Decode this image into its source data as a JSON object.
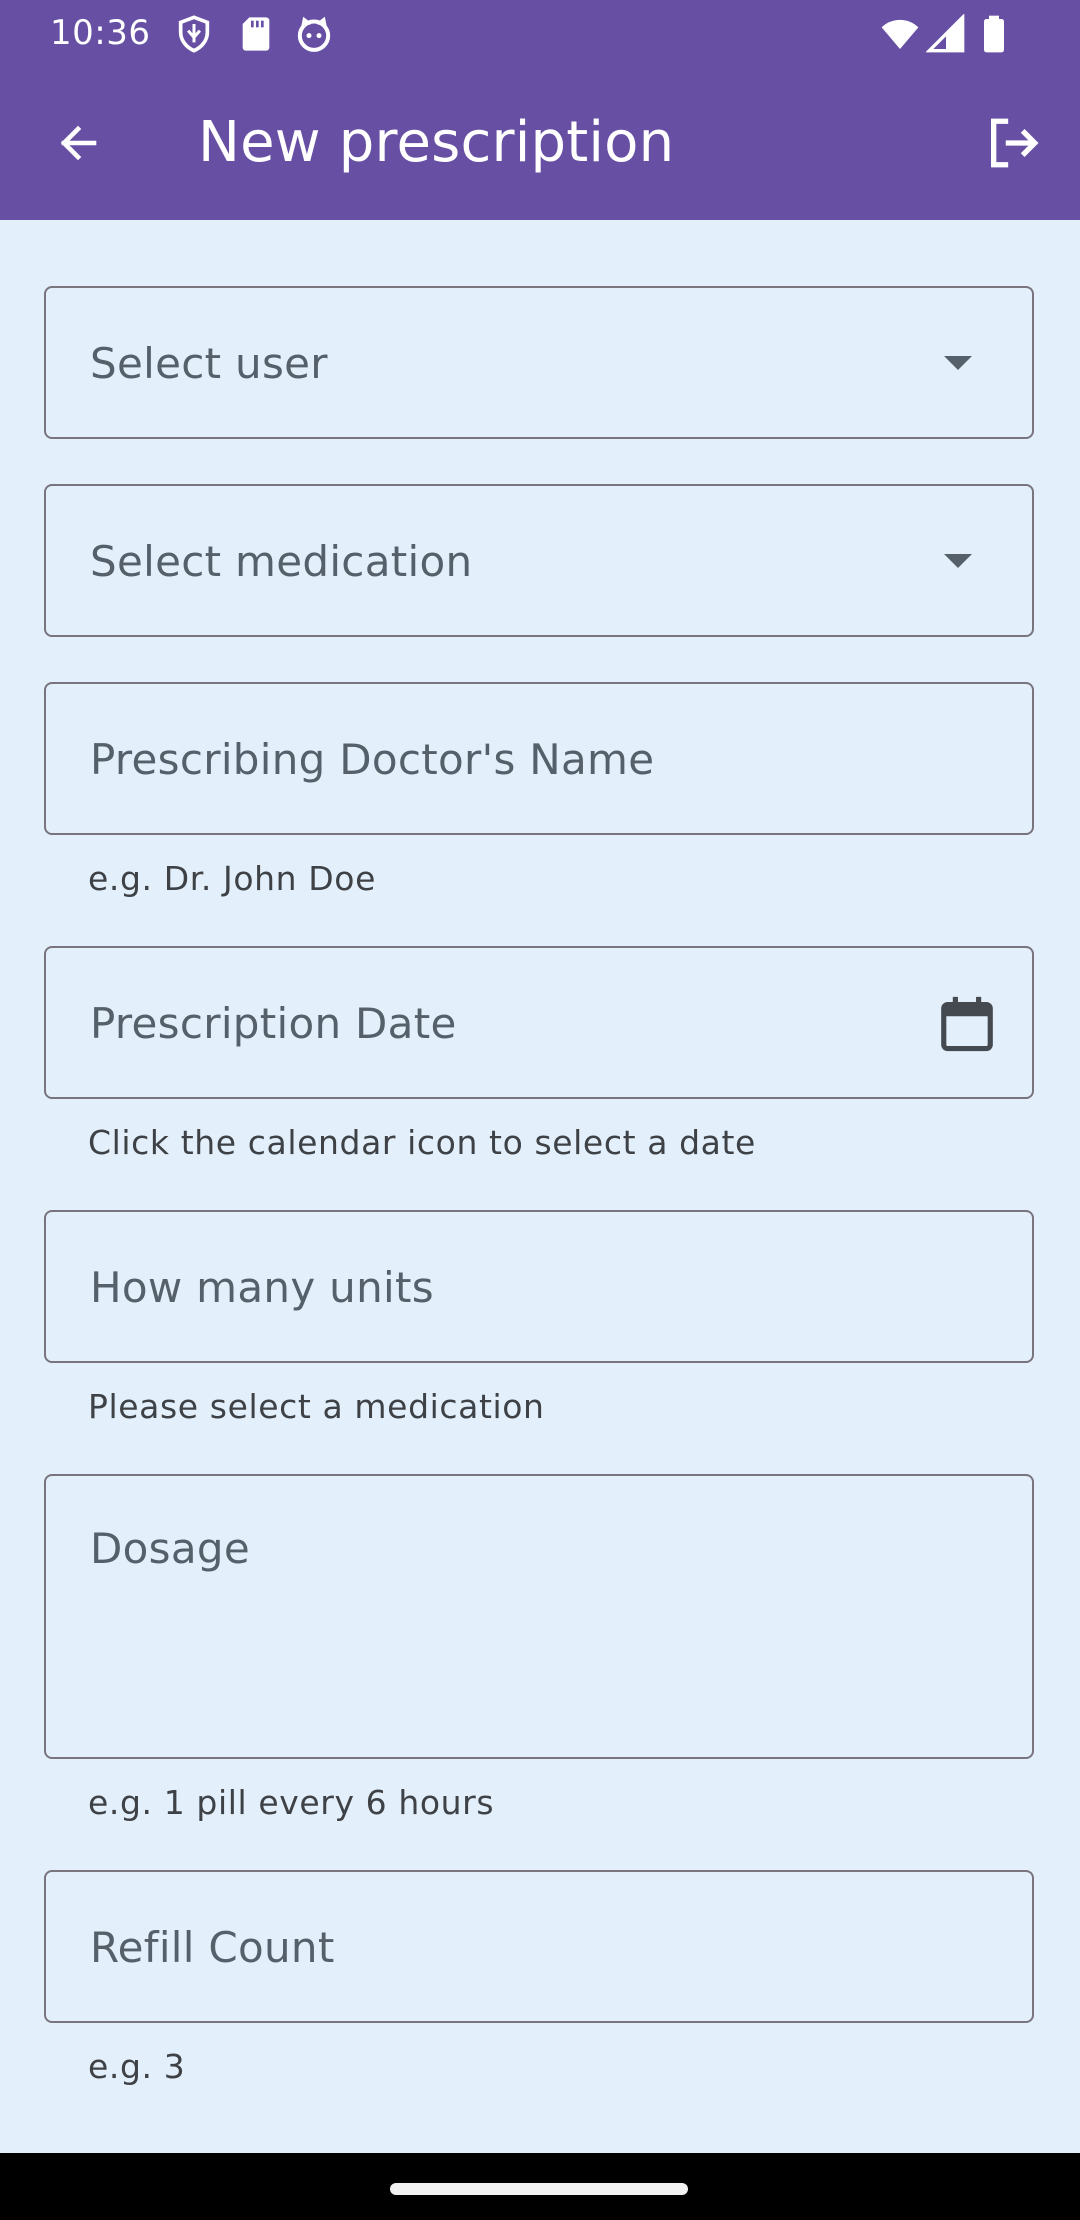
{
  "status_bar": {
    "time": "10:36",
    "icons": [
      "shield-icon",
      "sd-card-icon",
      "cat-face-icon",
      "wifi-icon",
      "signal-icon",
      "battery-icon"
    ]
  },
  "app_bar": {
    "title": "New prescription",
    "back_icon": "arrow-back-icon",
    "logout_icon": "logout-icon",
    "color": "#6750a4"
  },
  "form": {
    "user_select": {
      "placeholder": "Select user"
    },
    "medication_select": {
      "placeholder": "Select medication"
    },
    "doctor_name": {
      "placeholder": "Prescribing Doctor's Name",
      "helper": "e.g. Dr. John Doe"
    },
    "prescription_date": {
      "placeholder": "Prescription Date",
      "helper": "Click the calendar icon to select a date"
    },
    "units": {
      "placeholder": "How many units",
      "helper": "Please select a medication"
    },
    "dosage": {
      "placeholder": "Dosage",
      "helper": "e.g. 1 pill every 6 hours"
    },
    "refill_count": {
      "placeholder": "Refill Count",
      "helper": "e.g. 3"
    }
  },
  "colors": {
    "background": "#e3f0fb",
    "outline": "#79747e",
    "placeholder_text": "#55606a"
  }
}
